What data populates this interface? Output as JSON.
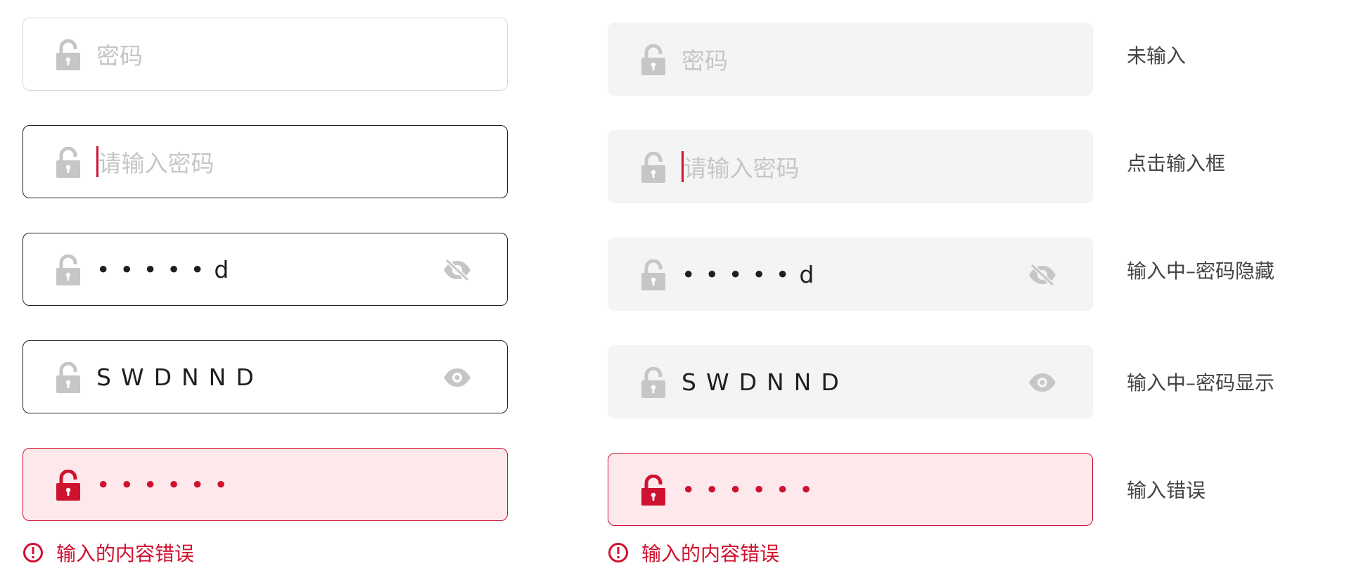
{
  "colors": {
    "accent_error": "#cf1230",
    "error_bg": "#fde8ec",
    "filled_bg": "#f3f4f4",
    "placeholder": "#c6c6c6",
    "icon_gray": "#c6c6c6"
  },
  "variant_a": {
    "idle_placeholder": "密码",
    "focus_placeholder": "请输入密码",
    "hidden_value": "•••••d",
    "shown_value": "SWDNND",
    "error_value": "••••••",
    "error_message": "输入的内容错误"
  },
  "variant_b": {
    "idle_placeholder": "密码",
    "focus_placeholder": "请输入密码",
    "hidden_value": "•••••d",
    "shown_value": "SWDNND",
    "error_value": "••••••",
    "error_message": "输入的内容错误"
  },
  "states": [
    {
      "label": "未输入"
    },
    {
      "label": "点击输入框"
    },
    {
      "label": "输入中–密码隐藏"
    },
    {
      "label": "输入中–密码显示"
    },
    {
      "label": "输入错误"
    }
  ],
  "icons": {
    "lock": "lock-icon",
    "eye_hidden": "eye-slash-icon",
    "eye_visible": "eye-icon",
    "error": "exclamation-circle-icon"
  }
}
